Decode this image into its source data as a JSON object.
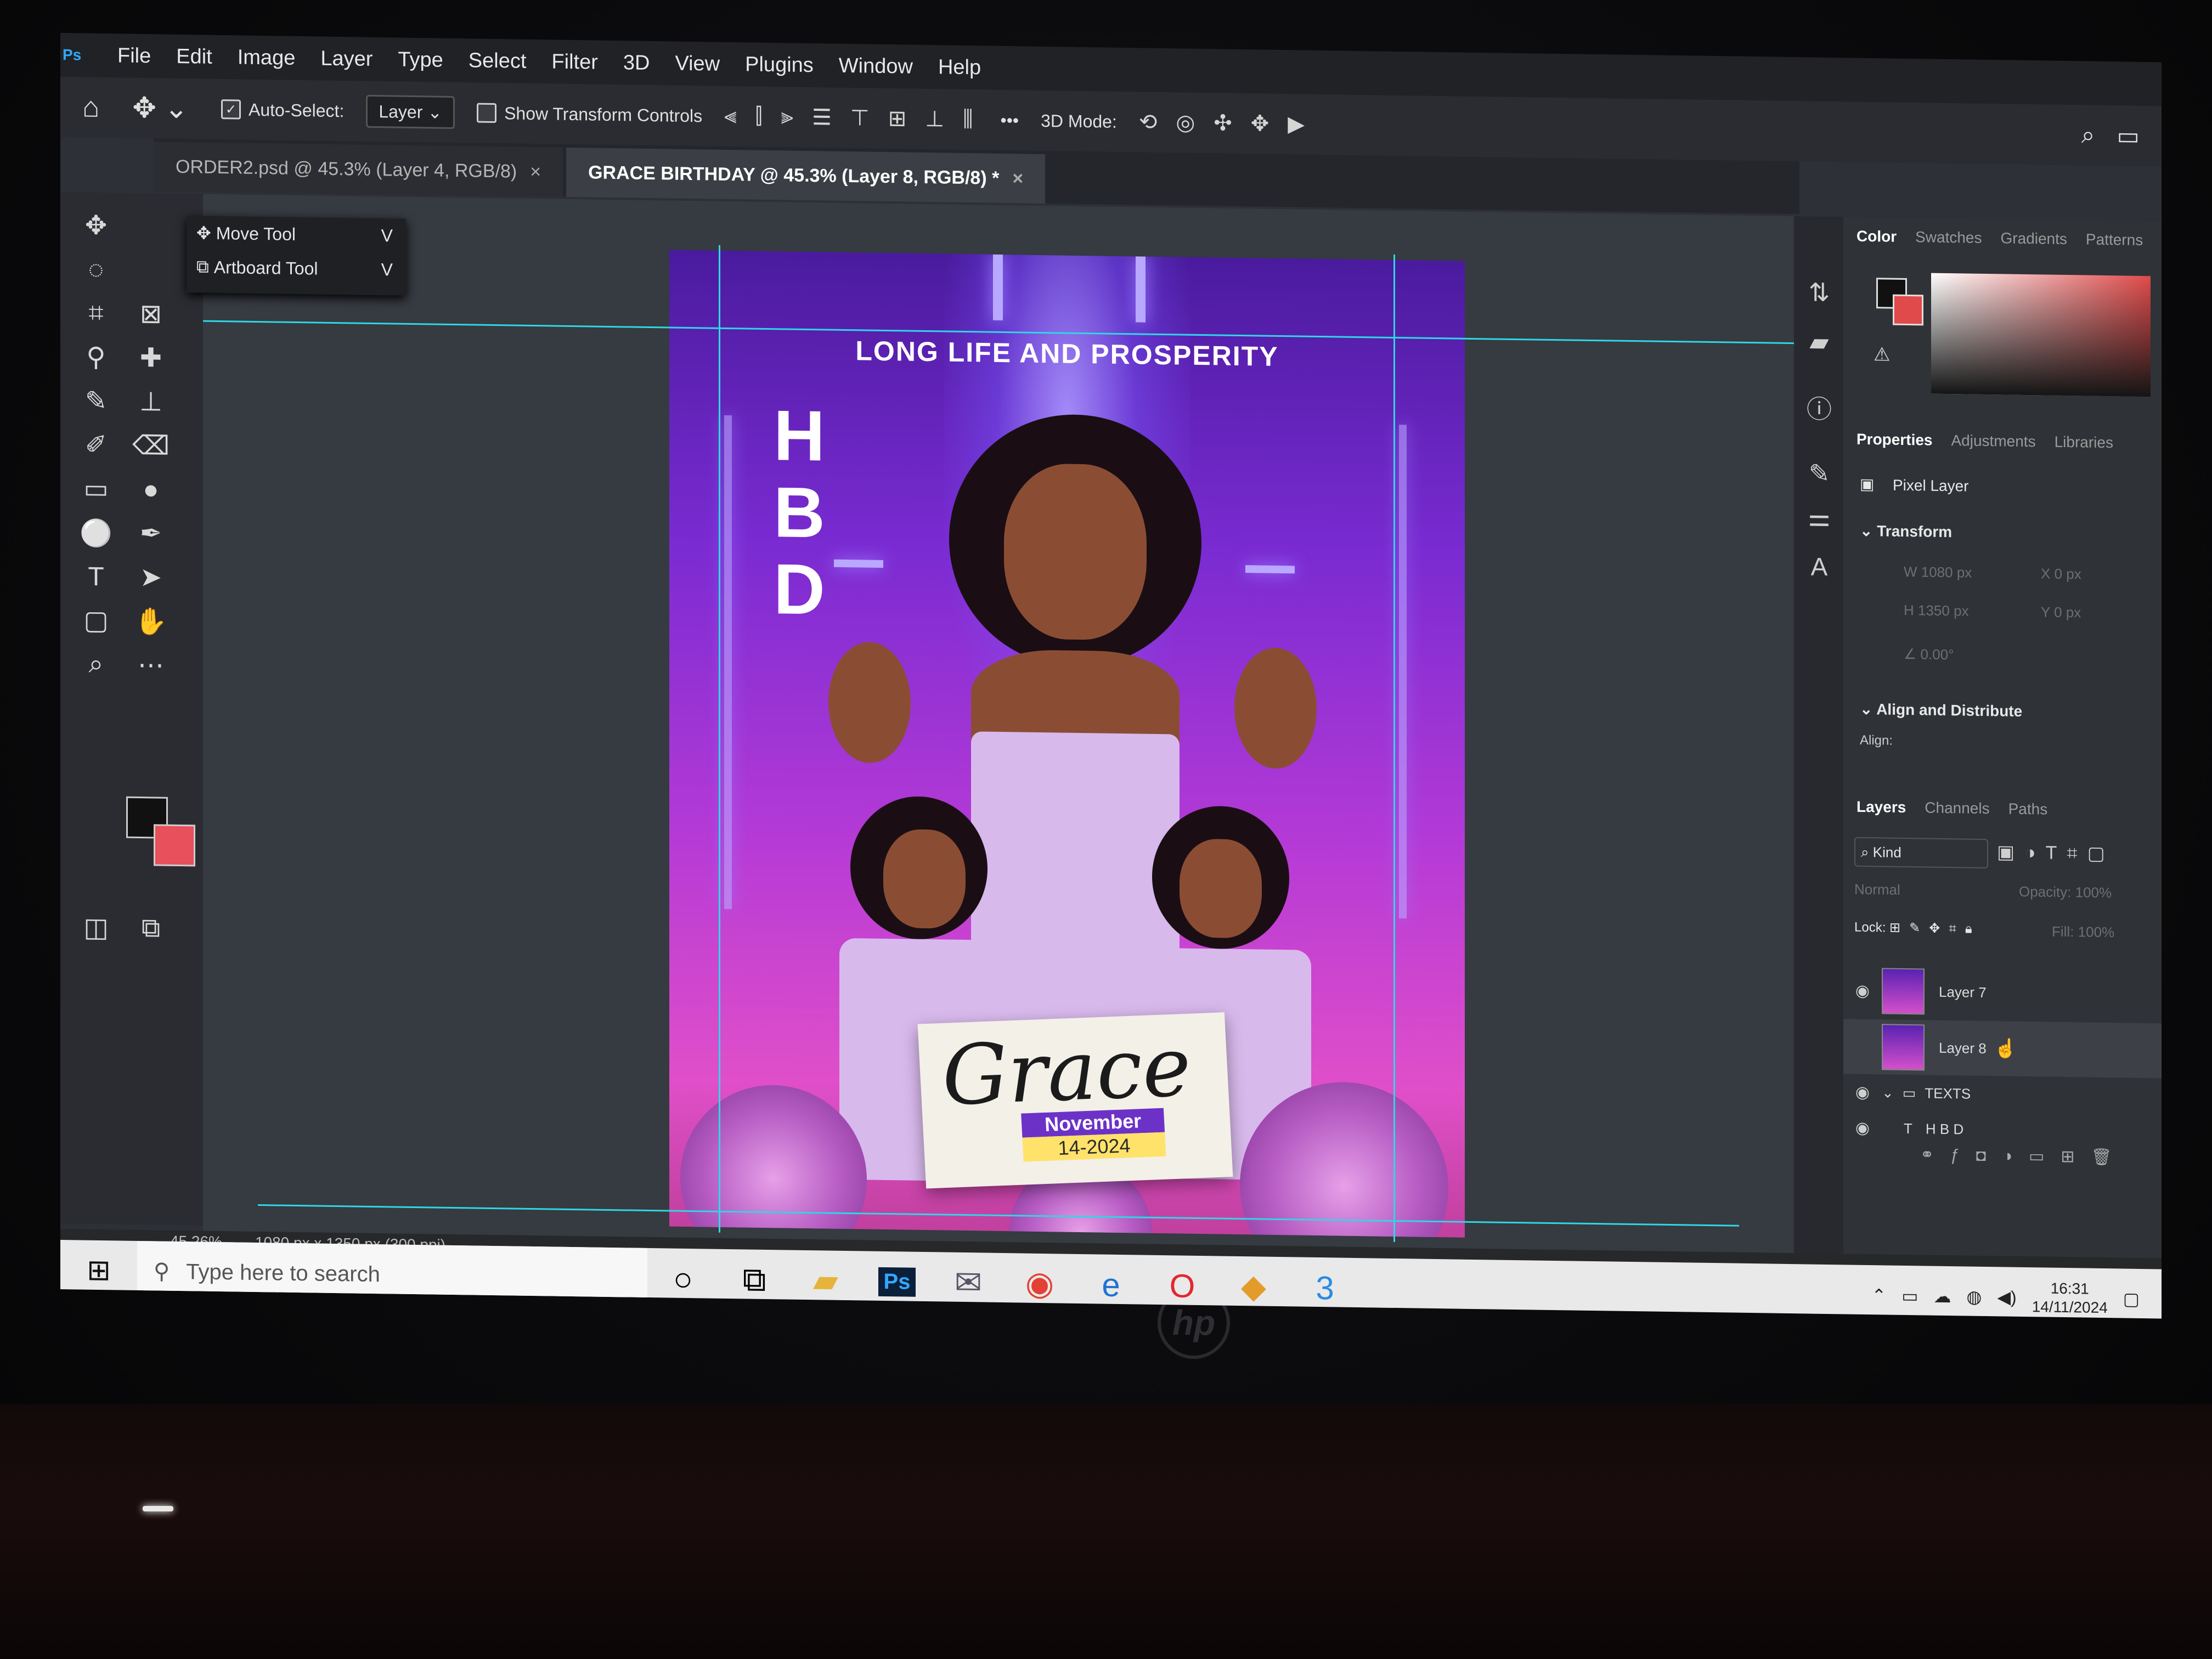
{
  "menu": {
    "ps_mark": "Ps",
    "items": [
      "File",
      "Edit",
      "Image",
      "Layer",
      "Type",
      "Select",
      "Filter",
      "3D",
      "View",
      "Plugins",
      "Window",
      "Help"
    ]
  },
  "options": {
    "auto_select_label": "Auto-Select:",
    "auto_select_value": "Layer",
    "show_transform_label": "Show Transform Controls",
    "three_d_mode_label": "3D Mode:",
    "more_label": "•••"
  },
  "tabs": [
    {
      "label": "ORDER2.psd @ 45.3% (Layer 4, RGB/8)"
    },
    {
      "label": "GRACE BIRTHDAY @ 45.3% (Layer 8, RGB/8) *"
    }
  ],
  "tool_flyout": {
    "move_tool": "Move Tool",
    "move_key": "V",
    "artboard_tool": "Artboard Tool",
    "artboard_key": "V"
  },
  "poster": {
    "headline": "LONG LIFE AND PROSPERITY",
    "hbd": [
      "H",
      "B",
      "D"
    ],
    "name": "Grace",
    "month": "November",
    "date": "14-2024"
  },
  "color_panel": {
    "tabs": [
      "Color",
      "Swatches",
      "Gradients",
      "Patterns"
    ],
    "fg": "#111111",
    "bg": "#e04a4a"
  },
  "properties_panel": {
    "tabs": [
      "Properties",
      "Adjustments",
      "Libraries"
    ],
    "layer_type": "Pixel Layer",
    "transform_label": "Transform",
    "w": "1080 px",
    "h": "1350 px",
    "x": "0 px",
    "y": "0 px",
    "angle": "0.00°",
    "align_label": "Align and Distribute",
    "align_sub": "Align:"
  },
  "layers_panel": {
    "tabs": [
      "Layers",
      "Channels",
      "Paths"
    ],
    "filter_kind": "Kind",
    "blend_mode": "Normal",
    "opacity_label": "Opacity:",
    "opacity_value": "100%",
    "lock_label": "Lock:",
    "fill_label": "Fill:",
    "fill_value": "100%",
    "rows": [
      {
        "name": "Layer 7"
      },
      {
        "name": "Layer 8"
      },
      {
        "name": "TEXTS"
      },
      {
        "name": "H B D"
      }
    ]
  },
  "status": {
    "zoom": "45.26%",
    "doc_size": "1080 px x 1350 px (300 ppi)"
  },
  "taskbar": {
    "search_placeholder": "Type here to search",
    "time": "16:31",
    "date": "14/11/2024"
  }
}
